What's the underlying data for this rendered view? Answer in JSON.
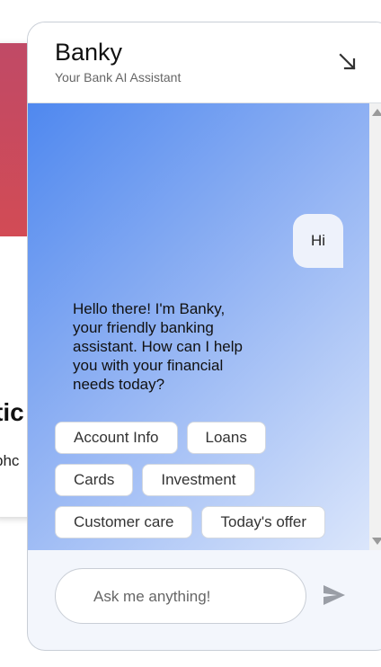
{
  "background": {
    "heading_fragment": "tic",
    "sub_fragment": "phc",
    "banner_color": "#d24b55"
  },
  "widget": {
    "title": "Banky",
    "subtitle": "Your Bank AI Assistant",
    "minimize_icon": "arrow-down-right-icon",
    "accent_color": "#4f88ef"
  },
  "chat": {
    "user_message": "Hi",
    "bot_message": "Hello there! I'm Banky, your friendly banking assistant. How can I help you with your financial needs today?",
    "quick_replies": [
      [
        "Account Info",
        "Loans"
      ],
      [
        "Cards",
        "Investment"
      ],
      [
        "Customer care",
        "Today's offer"
      ]
    ]
  },
  "composer": {
    "placeholder": "Ask me anything!",
    "value": "",
    "send_icon": "send-icon"
  }
}
